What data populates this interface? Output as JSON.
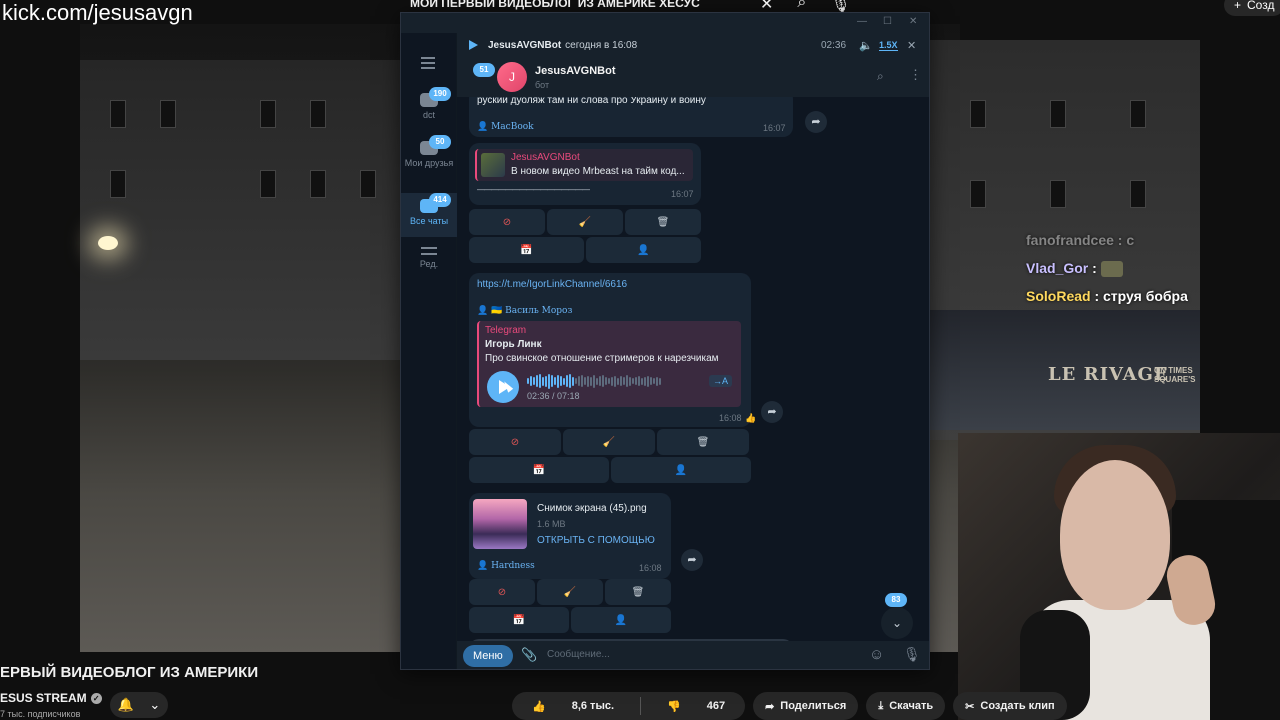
{
  "stream": {
    "url": "kick.com/jesusavgn",
    "top_title": "МОЙ ПЕРВЫЙ ВИДЕОБЛОГ ИЗ АМЕРИКЕ ХЕСУС",
    "create_label": "Созд",
    "cafe_sign": "LE RIVAGE",
    "cafe_sub1": "ON TIMES",
    "cafe_sub2": "SQUARE'S"
  },
  "chat_overlay": [
    {
      "user": "",
      "text": "fanofrandcee : с"
    },
    {
      "user": "Vlad_Gor",
      "text": " : "
    },
    {
      "user": "SoloRead",
      "text": " : струя бобра"
    }
  ],
  "youtube": {
    "title": "ЕРВЫЙ ВИДЕОБЛОГ ИЗ АМЕРИКИ",
    "channel": "ESUS STREAM",
    "subscribers": "7 тыс. подписчиков",
    "likes": "8,6 тыс.",
    "dislikes": "467",
    "share_label": "Поделиться",
    "download_label": "Скачать",
    "clip_label": "Создать клип"
  },
  "telegram": {
    "sidebar": [
      {
        "label": "dct",
        "badge": "190"
      },
      {
        "label": "Мои друзья",
        "badge": "50"
      },
      {
        "label": "Все чаты",
        "badge": "414"
      },
      {
        "label": "Ред.",
        "badge": ""
      }
    ],
    "player": {
      "name": "JesusAVGNBot",
      "when": "сегодня в 16:08",
      "time": "02:36",
      "speed": "1.5X"
    },
    "header": {
      "back_badge": "51",
      "avatar_letter": "J",
      "name": "JesusAVGNBot",
      "status": "бот"
    },
    "messages": {
      "m1_text": "руский дуоляж там ни слова про Украину и войну",
      "m1_sender": "MacBook",
      "m1_time": "16:07",
      "m2_quote_title": "JesusAVGNBot",
      "m2_quote_text": "В новом видео Mrbeast на тайм код...",
      "m2_line": "————————————————",
      "m2_time": "16:07",
      "m3_link": "https://t.me/IgorLinkChannel/6616",
      "m3_sender": "Василь Мороз",
      "m3_quote_title": "Telegram",
      "m3_author": "Игорь Линк",
      "m3_desc": "Про свинское отношение стримеров к нарезчикам",
      "m3_voice_time": "02:36 / 07:18",
      "m3_transcribe": "→A",
      "m3_time": "16:08",
      "m4_file_name": "Снимок экрана (45).png",
      "m4_file_size": "1.6 MB",
      "m4_open": "ОТКРЫТЬ С ПОМОЩЬЮ",
      "m4_sender": "Hardness",
      "m4_time": "16:08"
    },
    "unread_badge": "83",
    "input": {
      "menu_label": "Меню",
      "placeholder": "Сообщение..."
    }
  }
}
